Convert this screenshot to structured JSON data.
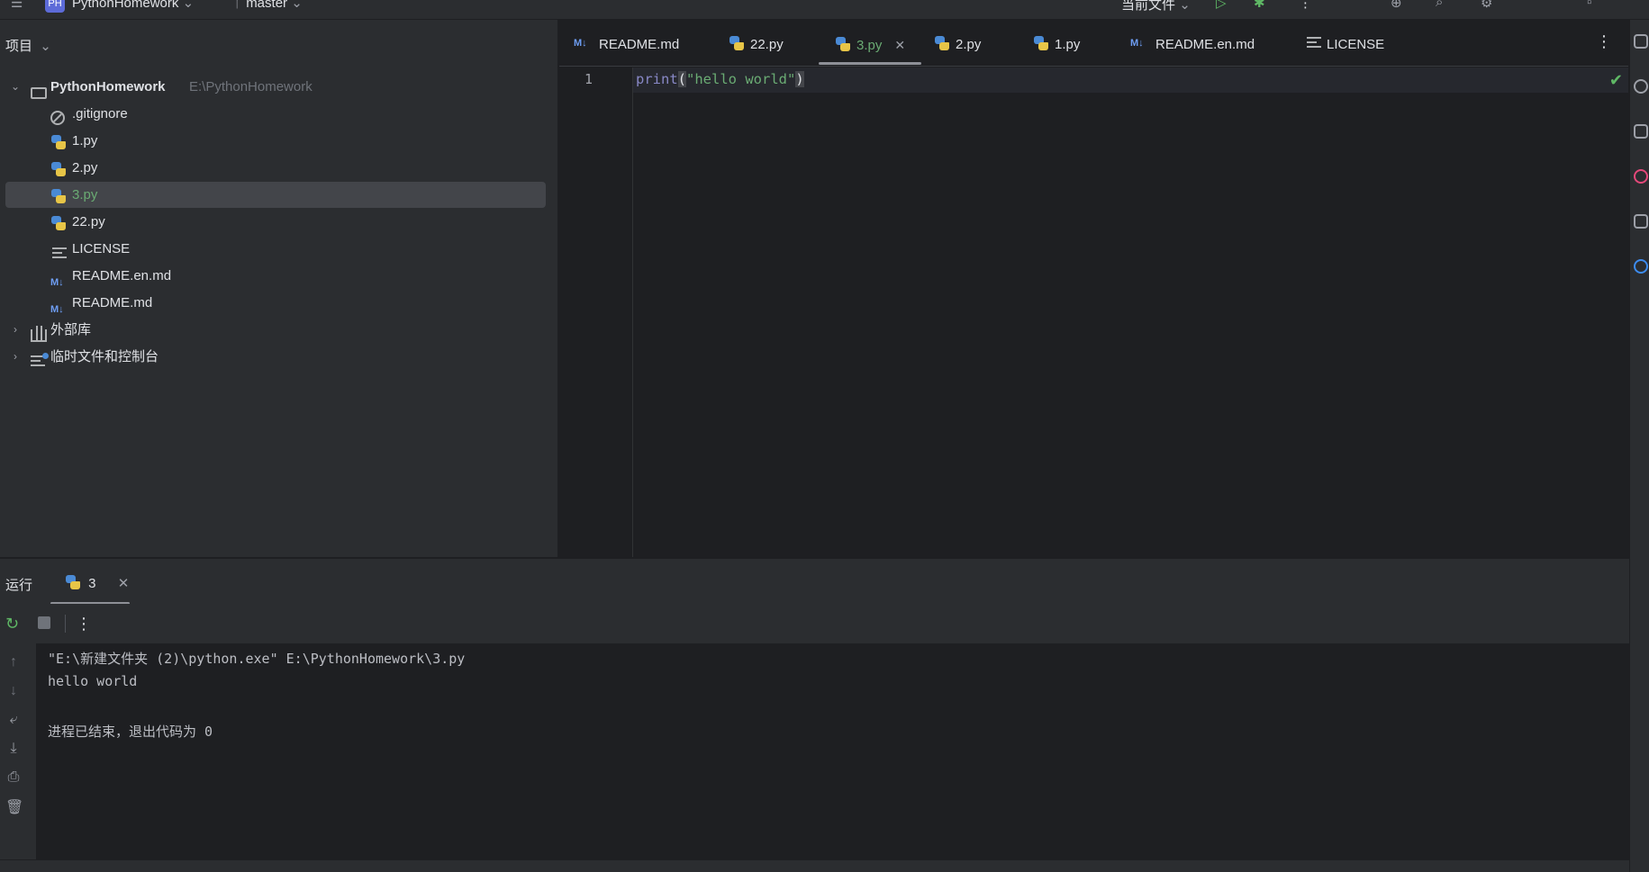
{
  "topbar": {
    "project_name": "PythonHomework",
    "project_badge": "PH",
    "branch": "master",
    "run_config": "当前文件"
  },
  "project_panel": {
    "header": "项目",
    "root": {
      "name": "PythonHomework",
      "path": "E:\\PythonHomework"
    },
    "files": [
      {
        "name": ".gitignore",
        "icon": "gitignore-icon"
      },
      {
        "name": "1.py",
        "icon": "python-file-icon"
      },
      {
        "name": "2.py",
        "icon": "python-file-icon"
      },
      {
        "name": "3.py",
        "icon": "python-file-icon",
        "selected": true
      },
      {
        "name": "22.py",
        "icon": "python-file-icon"
      },
      {
        "name": "LICENSE",
        "icon": "text-file-icon"
      },
      {
        "name": "README.en.md",
        "icon": "markdown-file-icon"
      },
      {
        "name": "README.md",
        "icon": "markdown-file-icon"
      }
    ],
    "external_libs": "外部库",
    "scratches": "临时文件和控制台"
  },
  "editor_tabs": [
    {
      "label": "README.md",
      "icon": "markdown-file-icon"
    },
    {
      "label": "22.py",
      "icon": "python-file-icon"
    },
    {
      "label": "3.py",
      "icon": "python-file-icon",
      "active": true
    },
    {
      "label": "2.py",
      "icon": "python-file-icon"
    },
    {
      "label": "1.py",
      "icon": "python-file-icon"
    },
    {
      "label": "README.en.md",
      "icon": "markdown-file-icon"
    },
    {
      "label": "LICENSE",
      "icon": "text-file-icon"
    }
  ],
  "editor": {
    "line_number": "1",
    "code": {
      "fn": "print",
      "open": "(",
      "str": "\"hello world\"",
      "close": ")"
    }
  },
  "run_panel": {
    "title": "运行",
    "tab_label": "3",
    "console": [
      "\"E:\\新建文件夹 (2)\\python.exe\" E:\\PythonHomework\\3.py",
      "hello world",
      "",
      "进程已结束，退出代码为 0"
    ]
  },
  "colors": {
    "accent_green": "#6aab73",
    "selection": "#43454a",
    "panel_bg": "#2b2d30",
    "editor_bg": "#1e1f22"
  }
}
